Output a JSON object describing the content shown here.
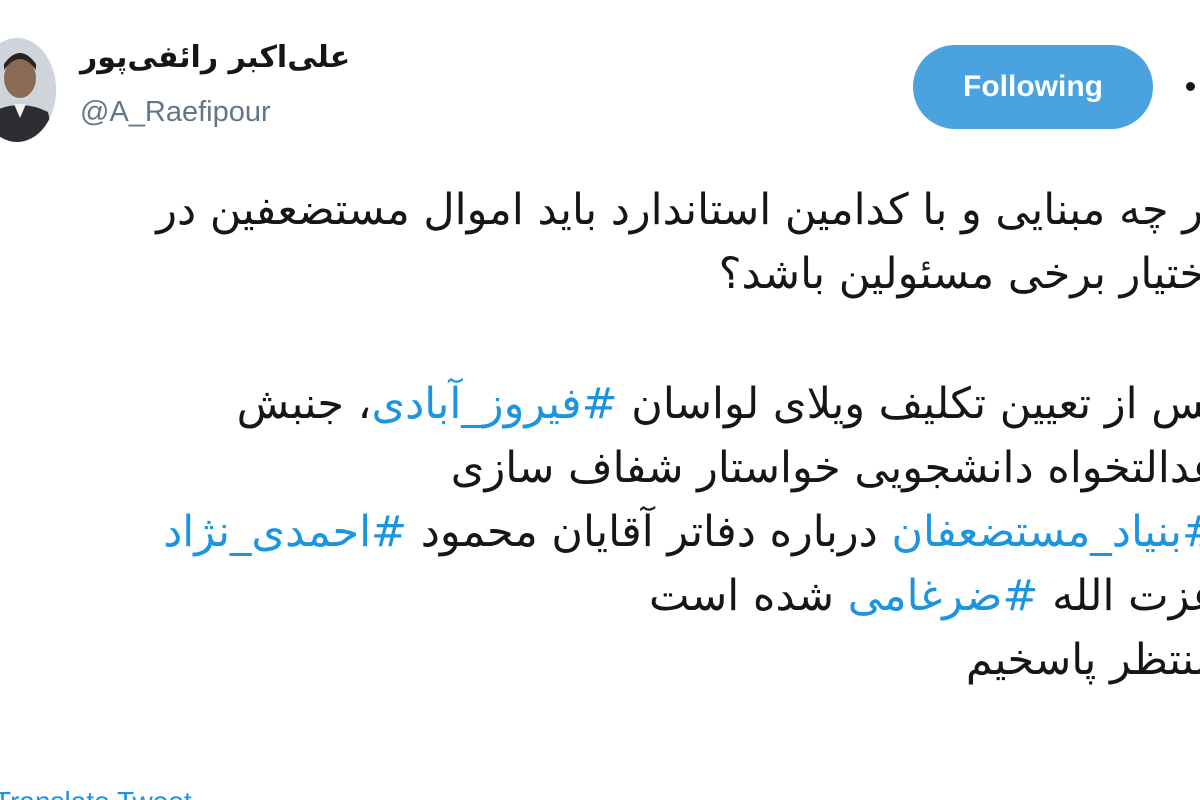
{
  "header": {
    "display_name": "علی‌اکبر رائفی‌پور",
    "handle": "@A_Raefipour",
    "follow_button_label": "Following"
  },
  "tweet": {
    "lines": [
      {
        "segments": [
          {
            "text": "بر چه مبنایی و با کدامین استاندارد باید اموال مستضعفین در",
            "hashtag": false
          }
        ]
      },
      {
        "segments": [
          {
            "text": "اختیار برخی مسئولین باشد؟",
            "hashtag": false
          }
        ]
      },
      {
        "segments": [
          {
            "text": "پس از تعیین تکلیف ویلای لواسان ",
            "hashtag": false
          },
          {
            "text": "#فیروز_آبادی",
            "hashtag": true
          },
          {
            "text": "، جنبش",
            "hashtag": false
          }
        ]
      },
      {
        "segments": [
          {
            "text": "عدالتخواه دانشجویی خواستار شفاف سازی",
            "hashtag": false
          }
        ]
      },
      {
        "segments": [
          {
            "text": "#بنیاد_مستضعفان",
            "hashtag": true
          },
          {
            "text": " درباره دفاتر آقایان محمود ",
            "hashtag": false
          },
          {
            "text": "#احمدی_نژاد",
            "hashtag": true
          }
        ]
      },
      {
        "segments": [
          {
            "text": "عزت الله ",
            "hashtag": false
          },
          {
            "text": "#ضرغامی",
            "hashtag": true
          },
          {
            "text": " شده است",
            "hashtag": false
          }
        ]
      },
      {
        "segments": [
          {
            "text": "منتظر پاسخیم",
            "hashtag": false
          }
        ]
      }
    ],
    "translate_label": "Translate Tweet"
  },
  "colors": {
    "follow_button_bg": "#4aa3df",
    "hashtag": "#1b95e0",
    "text": "#14171a",
    "handle": "#657786"
  },
  "icons": {
    "avatar": "profile-photo",
    "caret": "more-options-caret"
  }
}
